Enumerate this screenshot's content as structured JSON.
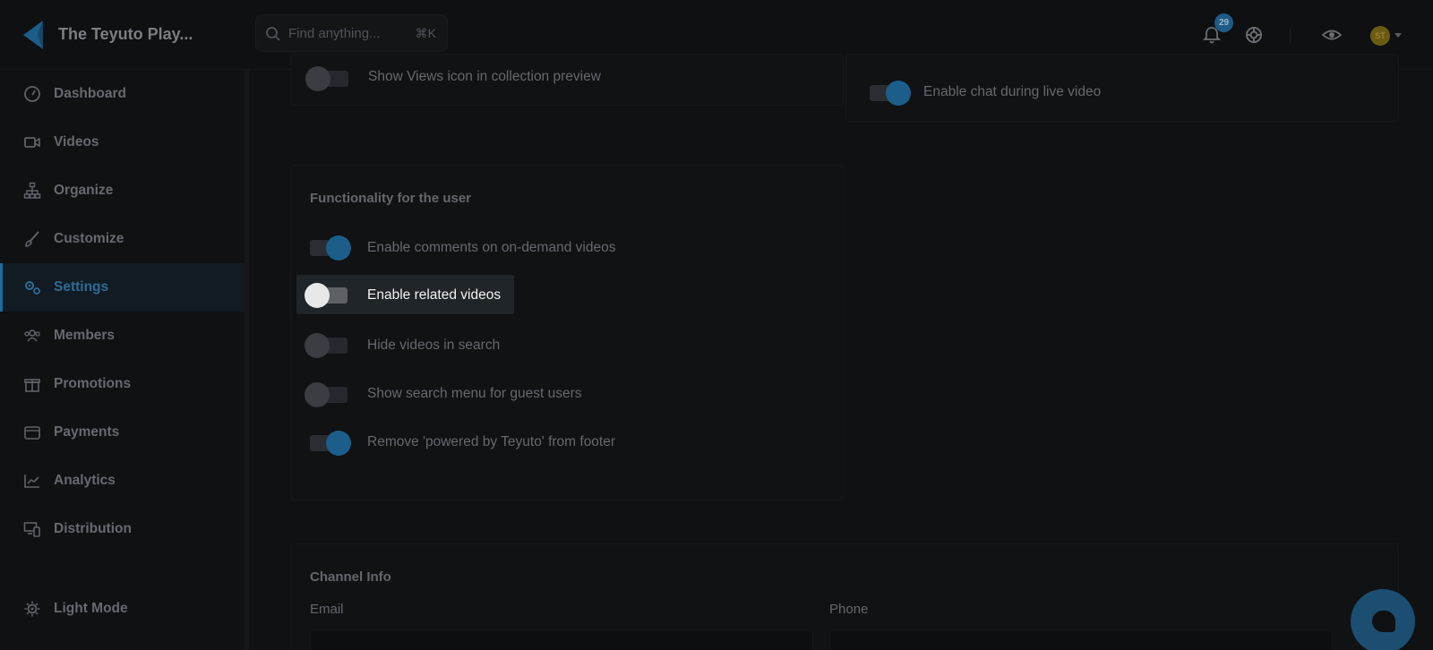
{
  "header": {
    "brand": "The Teyuto Play...",
    "search_placeholder": "Find anything...",
    "search_shortcut": "⌘K",
    "notification_count": "29",
    "avatar_initials": "ST"
  },
  "sidebar": {
    "items": [
      {
        "label": "Dashboard",
        "icon": "gauge-icon"
      },
      {
        "label": "Videos",
        "icon": "video-camera-icon"
      },
      {
        "label": "Organize",
        "icon": "sitemap-icon"
      },
      {
        "label": "Customize",
        "icon": "brush-icon"
      },
      {
        "label": "Settings",
        "icon": "gears-icon",
        "active": true
      },
      {
        "label": "Members",
        "icon": "users-icon"
      },
      {
        "label": "Promotions",
        "icon": "gift-icon"
      },
      {
        "label": "Payments",
        "icon": "wallet-icon"
      },
      {
        "label": "Analytics",
        "icon": "chart-line-icon"
      },
      {
        "label": "Distribution",
        "icon": "devices-icon"
      }
    ],
    "light_mode_label": "Light Mode"
  },
  "collection_card": {
    "show_views_label": "Show Views icon in collection preview",
    "show_views_on": false
  },
  "live_card": {
    "enable_chat_label": "Enable chat during live video",
    "enable_chat_on": true
  },
  "functionality": {
    "title": "Functionality for the user",
    "rows": [
      {
        "label": "Enable comments on on-demand videos",
        "on": true
      },
      {
        "label": "Enable related videos",
        "on": false,
        "highlighted": true
      },
      {
        "label": "Hide videos in search",
        "on": false
      },
      {
        "label": "Show search menu for guest users",
        "on": false
      },
      {
        "label": "Remove 'powered by Teyuto' from footer",
        "on": true
      }
    ]
  },
  "channel_info": {
    "title": "Channel Info",
    "email_label": "Email",
    "phone_label": "Phone"
  },
  "colors": {
    "accent": "#1e6b9f",
    "background": "#0f1113"
  }
}
